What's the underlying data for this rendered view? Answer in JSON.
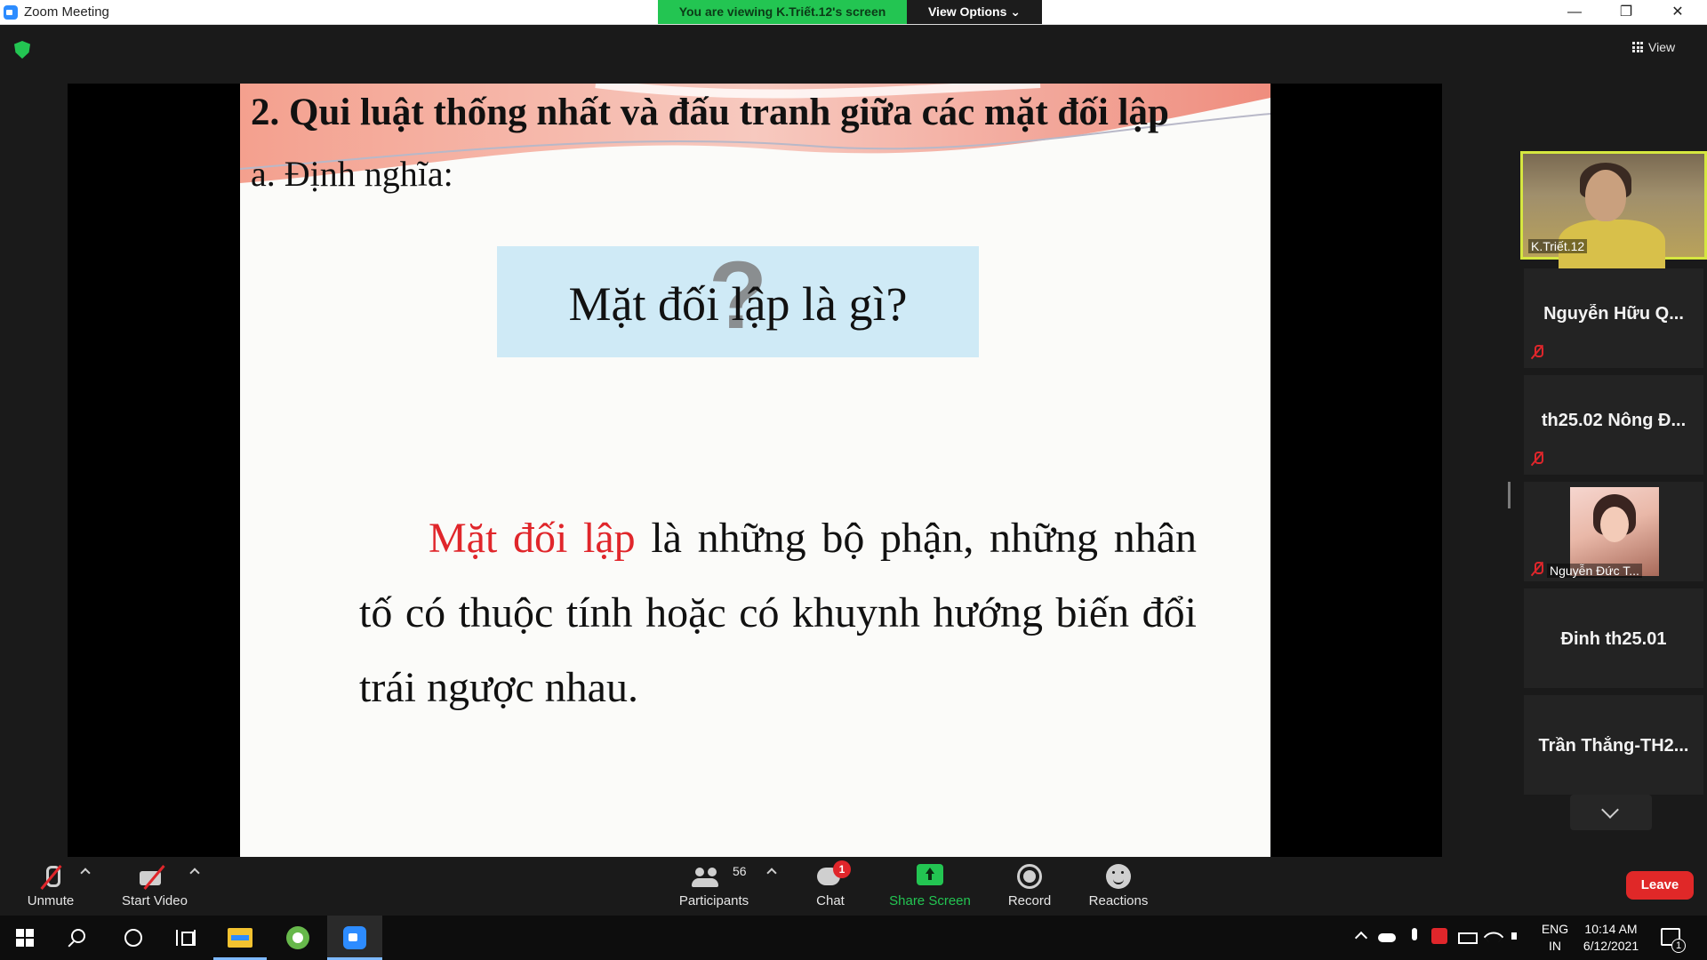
{
  "window": {
    "title": "Zoom Meeting",
    "viewing_banner": "You are viewing K.Triết.12's screen",
    "view_options": "View Options ⌄",
    "view_button": "View",
    "controls": {
      "minimize": "—",
      "maximize": "❐",
      "close": "✕"
    }
  },
  "slide": {
    "heading": "2. Qui luật thống nhất và đấu tranh giữa các mặt đối lập",
    "subheading": "a. Định nghĩa:",
    "question": "Mặt đối lập là gì?",
    "question_mark": "?",
    "definition_term": "Mặt đối lập",
    "definition_rest": " là những bộ phận, những nhân tố có thuộc tính hoặc có khuynh hướng biến đổi trái ngược nhau."
  },
  "participants_panel": {
    "tiles": [
      {
        "name": "K.Triết.12",
        "muted": false,
        "video": true
      },
      {
        "name": "Nguyễn Hữu Q...",
        "muted": true
      },
      {
        "name": "th25.02 Nông Đ...",
        "muted": true
      },
      {
        "name": "Nguyễn Đức T...",
        "muted": true,
        "photo": true
      },
      {
        "name": "Đinh th25.01",
        "muted": false
      },
      {
        "name": "Trần Thắng-TH2...",
        "muted": false
      }
    ]
  },
  "toolbar": {
    "unmute": "Unmute",
    "start_video": "Start Video",
    "participants": "Participants",
    "participants_count": "56",
    "chat": "Chat",
    "chat_badge": "1",
    "share_screen": "Share Screen",
    "record": "Record",
    "reactions": "Reactions",
    "leave": "Leave"
  },
  "taskbar": {
    "language_line1": "ENG",
    "language_line2": "IN",
    "time": "10:14 AM",
    "date": "6/12/2021",
    "notification_count": "1"
  },
  "colors": {
    "accent_green": "#23c552",
    "leave_red": "#e02828",
    "term_red": "#e0262b",
    "active_speaker_border": "#d6e740",
    "question_box": "#cfeaf6"
  }
}
